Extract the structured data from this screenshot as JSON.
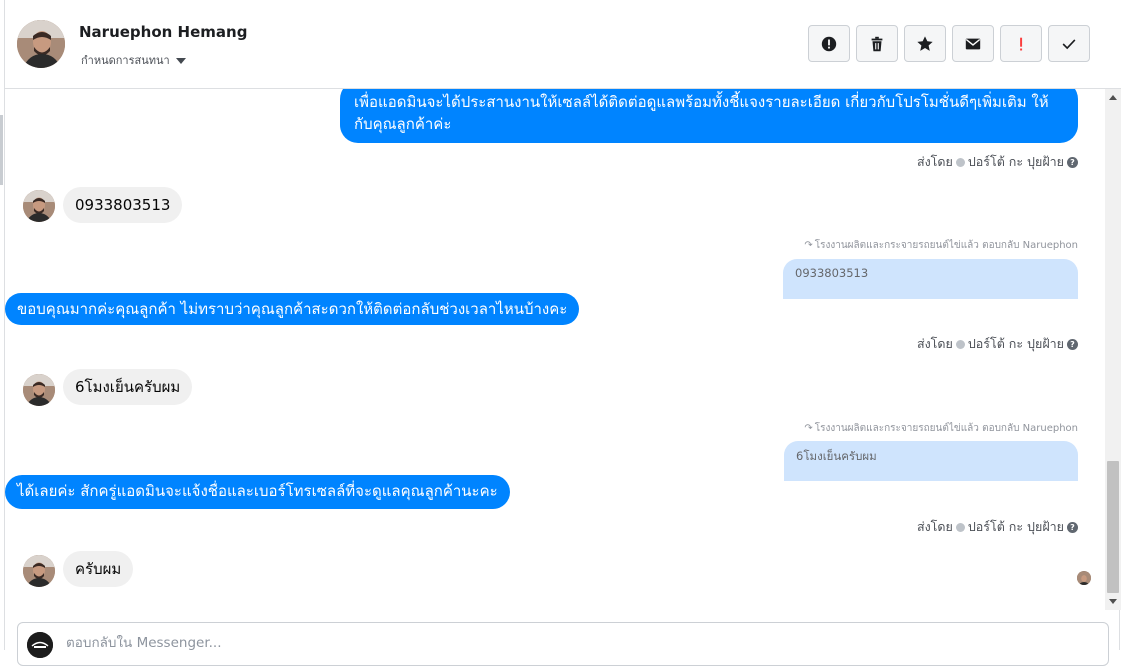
{
  "header": {
    "contact_name": "Naruephon Hemang",
    "assign_label": "กำหนดการสนทนา",
    "toolbar": [
      {
        "name": "alert-circle-icon",
        "color": "#1c1e21"
      },
      {
        "name": "trash-icon",
        "color": "#1c1e21"
      },
      {
        "name": "star-icon",
        "color": "#1c1e21"
      },
      {
        "name": "mail-icon",
        "color": "#1c1e21"
      },
      {
        "name": "exclamation-icon",
        "color": "#fa3e3e"
      },
      {
        "name": "check-icon",
        "color": "#1c1e21"
      }
    ]
  },
  "messages": {
    "m1": {
      "text": "เพื่อแอดมินจะได้ประสานงานให้เซลล์ได้ติดต่อดูแลพร้อมทั้งชี้แจงรายละเอียด เกี่ยวกับโปรโมชั่นดีๆเพิ่มเติม ให้กับคุณลูกค้าค่ะ",
      "sent_by_prefix": "ส่งโดย",
      "sent_by_name": "ปอร์โต้ กะ ปุยฝ้าย"
    },
    "m2": {
      "text": "0933803513"
    },
    "m3": {
      "reply_note": "โรงงานผลิตและกระจายรถยนต์ไข่แล้ว ตอบกลับ Naruephon",
      "quote": "0933803513",
      "text": "ขอบคุณมากค่ะคุณลูกค้า ไม่ทราบว่าคุณลูกค้าสะดวกให้ติดต่อกลับช่วงเวลาไหนบ้างคะ",
      "sent_by_prefix": "ส่งโดย",
      "sent_by_name": "ปอร์โต้ กะ ปุยฝ้าย"
    },
    "m4": {
      "text": "6โมงเย็นครับผม"
    },
    "m5": {
      "reply_note": "โรงงานผลิตและกระจายรถยนต์ไข่แล้ว ตอบกลับ Naruephon",
      "quote": "6โมงเย็นครับผม",
      "text": "ได้เลยค่ะ สักครู่แอดมินจะแจ้งชื่อและเบอร์โทรเซลล์ที่จะดูแลคุณลูกค้านะคะ",
      "sent_by_prefix": "ส่งโดย",
      "sent_by_name": "ปอร์โต้ กะ ปุยฝ้าย"
    },
    "m6": {
      "text": "ครับผม"
    }
  },
  "composer": {
    "placeholder": "ตอบกลับใน Messenger..."
  },
  "colors": {
    "outgoing_bubble": "#0084ff",
    "incoming_bubble": "#f0f0f0",
    "quote_bubble": "#cfe4fd"
  }
}
